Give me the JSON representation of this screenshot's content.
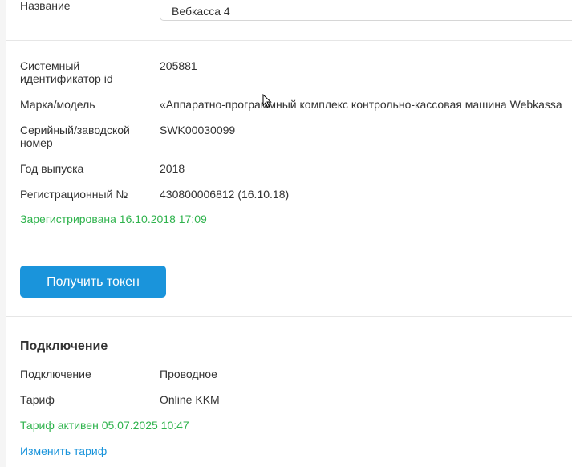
{
  "device": {
    "name_label": "Название",
    "name_value": "Вебкасса 4",
    "fields": [
      {
        "label": "Системный идентификатор id",
        "value": "205881"
      },
      {
        "label": "Марка/модель",
        "value": "«Аппаратно-программный комплекс контрольно-кассовая машина Webkassa"
      },
      {
        "label": "Серийный/заводской номер",
        "value": "SWK00030099"
      },
      {
        "label": "Год выпуска",
        "value": "2018"
      },
      {
        "label": "Регистрационный №",
        "value": "430800006812 (16.10.18)"
      }
    ],
    "registration_status": "Зарегистрирована 16.10.2018 17:09",
    "status_color": "#2fb34d"
  },
  "actions": {
    "get_token_label": "Получить токен",
    "accent_color": "#1a94db"
  },
  "connection": {
    "section_title": "Подключение",
    "fields": [
      {
        "label": "Подключение",
        "value": "Проводное"
      },
      {
        "label": "Тариф",
        "value": "Online KKM"
      }
    ],
    "tariff_status": "Тариф активен 05.07.2025 10:47",
    "change_tariff_label": "Изменить тариф"
  },
  "icons": {
    "cursor": "mouse-cursor-icon"
  }
}
